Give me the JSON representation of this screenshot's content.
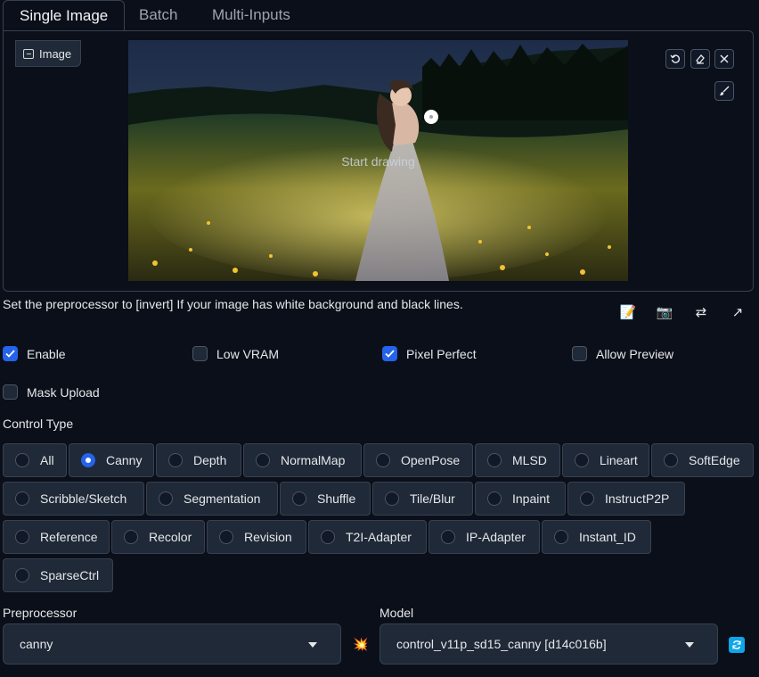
{
  "tabs": [
    "Single Image",
    "Batch",
    "Multi-Inputs"
  ],
  "image_panel": {
    "label": "Image",
    "overlay_text": "Start drawing",
    "tools": [
      "undo-icon",
      "eraser-icon",
      "close-icon",
      "brush-icon"
    ]
  },
  "hint": "Set the preprocessor to [invert] If your image has white background and black lines.",
  "actions": [
    "notes-icon",
    "camera-icon",
    "swap-icon",
    "send-icon"
  ],
  "options": {
    "enable": {
      "label": "Enable",
      "checked": true
    },
    "low_vram": {
      "label": "Low VRAM",
      "checked": false
    },
    "pixel_perfect": {
      "label": "Pixel Perfect",
      "checked": true
    },
    "allow_preview": {
      "label": "Allow Preview",
      "checked": false
    },
    "mask_upload": {
      "label": "Mask Upload",
      "checked": false
    }
  },
  "control_type": {
    "label": "Control Type",
    "selected": "Canny",
    "items": [
      "All",
      "Canny",
      "Depth",
      "NormalMap",
      "OpenPose",
      "MLSD",
      "Lineart",
      "SoftEdge",
      "Scribble/Sketch",
      "Segmentation",
      "Shuffle",
      "Tile/Blur",
      "Inpaint",
      "InstructP2P",
      "Reference",
      "Recolor",
      "Revision",
      "T2I-Adapter",
      "IP-Adapter",
      "Instant_ID",
      "SparseCtrl"
    ]
  },
  "preprocessor": {
    "label": "Preprocessor",
    "value": "canny"
  },
  "model": {
    "label": "Model",
    "value": "control_v11p_sd15_canny [d14c016b]"
  },
  "colors": {
    "accent": "#2563eb",
    "background": "#0b0f19",
    "surface": "#1f2937",
    "border": "#374151"
  }
}
